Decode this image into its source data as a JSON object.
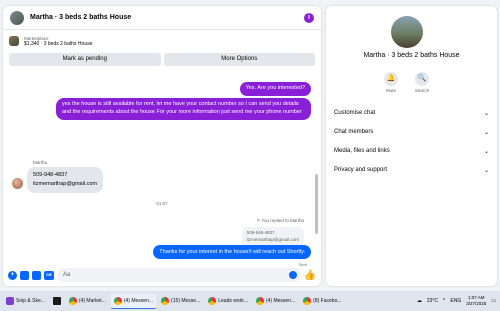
{
  "chat": {
    "title": "Martha · 3 beds 2 baths House",
    "listing": {
      "source": "Marketplace",
      "price_title": "$1,340 · 3 beds 2 baths House"
    },
    "actions": {
      "mark_pending": "Mark as pending",
      "more_options": "More Options"
    },
    "messages": {
      "out1": "Yes. Are you interested?",
      "out2": "yes the house is still available for rent, let me have your contact number so I can send you details and the requirements about the house For  your  more  information  just  send  me  your  phone  number",
      "sender": "Martha",
      "in_phone": "509-948-4837",
      "in_email": "itzmemarthap@gmail.com",
      "timestamp": "01:07",
      "replied_to": "You replied to Martha",
      "quoted_phone": "509-948-4837",
      "quoted_email": "itzmemarthap@gmail.com",
      "out3": "Thanks for your interest in the house!I will reach out Shortly.",
      "sent": "Sent"
    },
    "composer": {
      "placeholder": "Aa"
    }
  },
  "info_panel": {
    "name": "Martha · 3 beds 2 baths House",
    "mute": "Mute",
    "search": "Search",
    "sections": [
      "Customise chat",
      "Chat members",
      "Media, files and links",
      "Privacy and support"
    ]
  },
  "taskbar": {
    "items": [
      "Snip & Ske...",
      "(4) Market...",
      "(4) Messen...",
      "(15) Messe...",
      "Leads work...",
      "(4) Messen...",
      "(8) Facebo..."
    ],
    "temperature": "23°C",
    "lang": "ENG",
    "time": "1:07 AM",
    "date": "3/27/2025"
  },
  "colors": {
    "purple": "#8a1fd8",
    "blue": "#0866ff"
  }
}
